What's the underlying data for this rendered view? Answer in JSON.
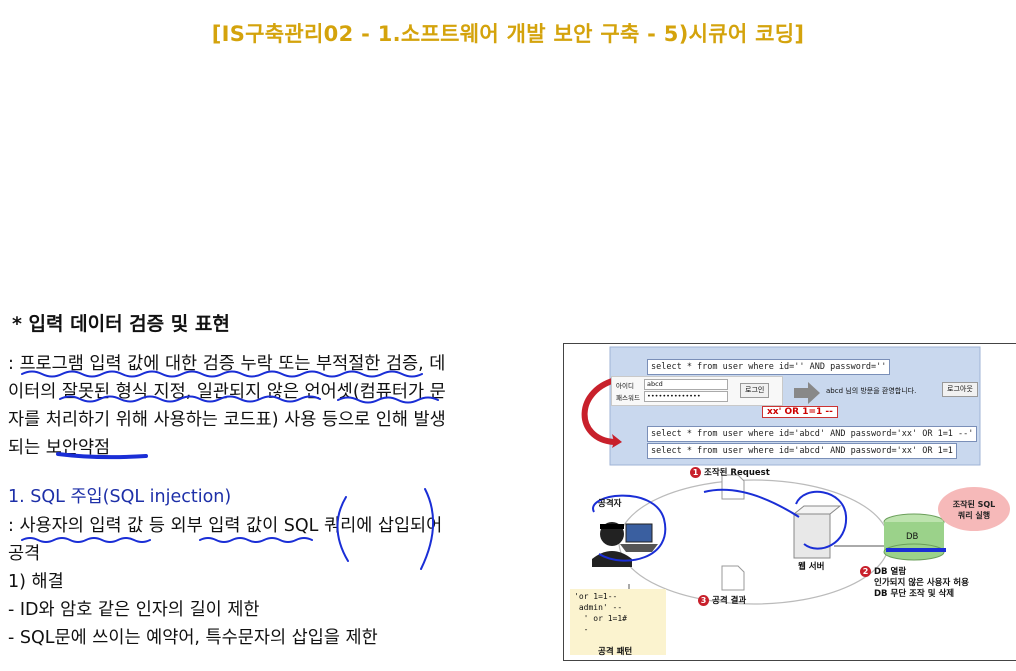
{
  "slide": {
    "title": "[IS구축관리02 - 1.소프트웨어 개발 보안 구축 - 5)시큐어 코딩]",
    "heading": "* 입력 데이터 검증 및 표현",
    "definition_lines": [
      ": 프로그램 입력 값에 대한 검증 누락 또는 부적절한 검증, 데",
      "이터의 잘못된 형식 지정, 일관되지 않은 언어셋(컴퓨터가 문",
      "자를 처리하기 위해 사용하는 코드표) 사용 등으로 인해 발생",
      "되는 보안약점"
    ],
    "section_title": "1. SQL 주입(SQL injection)",
    "section_lines": [
      ": 사용자의 입력 값 등 외부 입력 값이 SQL 쿼리에 삽입되어",
      "공격",
      "1) 해결",
      "- ID와 암호 같은 인자의 길이 제한",
      "- SQL문에 쓰이는 예약어, 특수문자의 삽입을 제한"
    ]
  },
  "diagram": {
    "query_top": "select * from user where id='' AND password=''",
    "login_id_label": "아이디",
    "login_pw_label": "패스워드",
    "login_id_value": "abcd",
    "login_pw_value": "••••••••••••••",
    "login_button": "로그인",
    "welcome_text": "abcd 님의 방문을 환영합니다.",
    "logout_button": "로그아웃",
    "injected_input": "xx' OR 1=1 --",
    "query_injected_1": "select * from user where id='abcd' AND password='xx' OR 1=1 --'",
    "query_injected_2": "select * from user where id='abcd' AND password='xx' OR 1=1",
    "step1": "조작된 Request",
    "step2_lines": [
      "DB 열람",
      "인가되지 않은 사용자 허용",
      "DB 무단 조작 및 삭제"
    ],
    "step3": "공격 결과",
    "attacker_label": "공격자",
    "webserver_label": "웹 서버",
    "db_label": "DB",
    "cloud_lines": [
      "조작된 SQL",
      "쿼리 실행"
    ],
    "pattern_lines": [
      "'or 1=1--",
      " admin' --",
      "  ' or 1=1#",
      "  -"
    ],
    "pattern_caption": "공격 패턴",
    "step_numbers": [
      "1",
      "2",
      "3"
    ],
    "colors": {
      "panel_bg": "#c9d8ee",
      "arrow_red": "#c8202b",
      "db_green": "#9bd28a",
      "cloud_pink": "#f6b9b9",
      "pattern_bg": "#fbf3cf"
    }
  },
  "colors": {
    "title": "#d4a30c",
    "section_title": "#1d2fa8",
    "ink_blue": "#1a2ed6"
  }
}
